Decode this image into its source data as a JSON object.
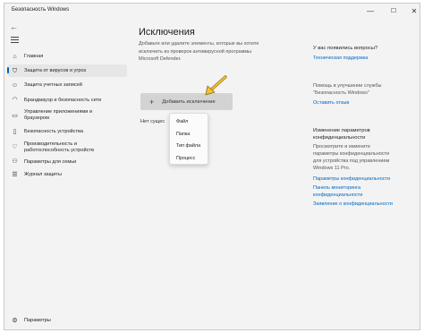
{
  "window": {
    "title": "Безопасность Windows",
    "controls": {
      "minimize": "—",
      "maximize": "☐",
      "close": "✕"
    }
  },
  "nav": {
    "back": "←",
    "items": [
      {
        "label": "Главная",
        "icon": "home-icon"
      },
      {
        "label": "Защита от вирусов и угроз",
        "icon": "shield-icon",
        "active": true
      },
      {
        "label": "Защита учетных записей",
        "icon": "person-icon"
      },
      {
        "label": "Брандмауэр и безопасность сети",
        "icon": "wifi-icon"
      },
      {
        "label": "Управление приложениями и браузером",
        "icon": "app-browser-icon"
      },
      {
        "label": "Безопасность устройства",
        "icon": "device-icon"
      },
      {
        "label": "Производительность и работоспособность устройств",
        "icon": "heart-icon"
      },
      {
        "label": "Параметры для семьи",
        "icon": "family-icon"
      },
      {
        "label": "Журнал защиты",
        "icon": "history-icon"
      }
    ],
    "settings": {
      "label": "Параметры",
      "icon": "gear-icon"
    }
  },
  "main": {
    "title": "Исключения",
    "description": [
      "Добавьте или удалите элементы, которые вы хотите",
      "исключить из проверок антивирусной программы",
      "Microsoft Defender."
    ],
    "add_button": {
      "plus": "+",
      "label": "Добавить исключение"
    },
    "no_exclusions": "Нет сущес",
    "dropdown_options": [
      "Файл",
      "Папка",
      "Тип файла",
      "Процесс"
    ]
  },
  "right": {
    "help": {
      "heading": "У вас появились вопросы?",
      "link": "Техническая поддержка"
    },
    "improve": {
      "text": [
        "Помощь в улучшении службы",
        "\"Безопасность Windows\""
      ],
      "link": "Оставить отзыв"
    },
    "privacy": {
      "heading": [
        "Изменение параметров",
        "конфиденциальности"
      ],
      "text": [
        "Просмотрите и измените",
        "параметры конфиденциальности",
        "для устройства под управлением",
        "Windows 11 Pro."
      ],
      "links": [
        "Параметры конфиденциальности",
        "Панель мониторинга",
        "конфиденциальности",
        "Заявление о конфиденциальности"
      ]
    }
  },
  "colors": {
    "accent": "#005fb8",
    "link": "#0067c0",
    "arrow": "#f2c230"
  }
}
